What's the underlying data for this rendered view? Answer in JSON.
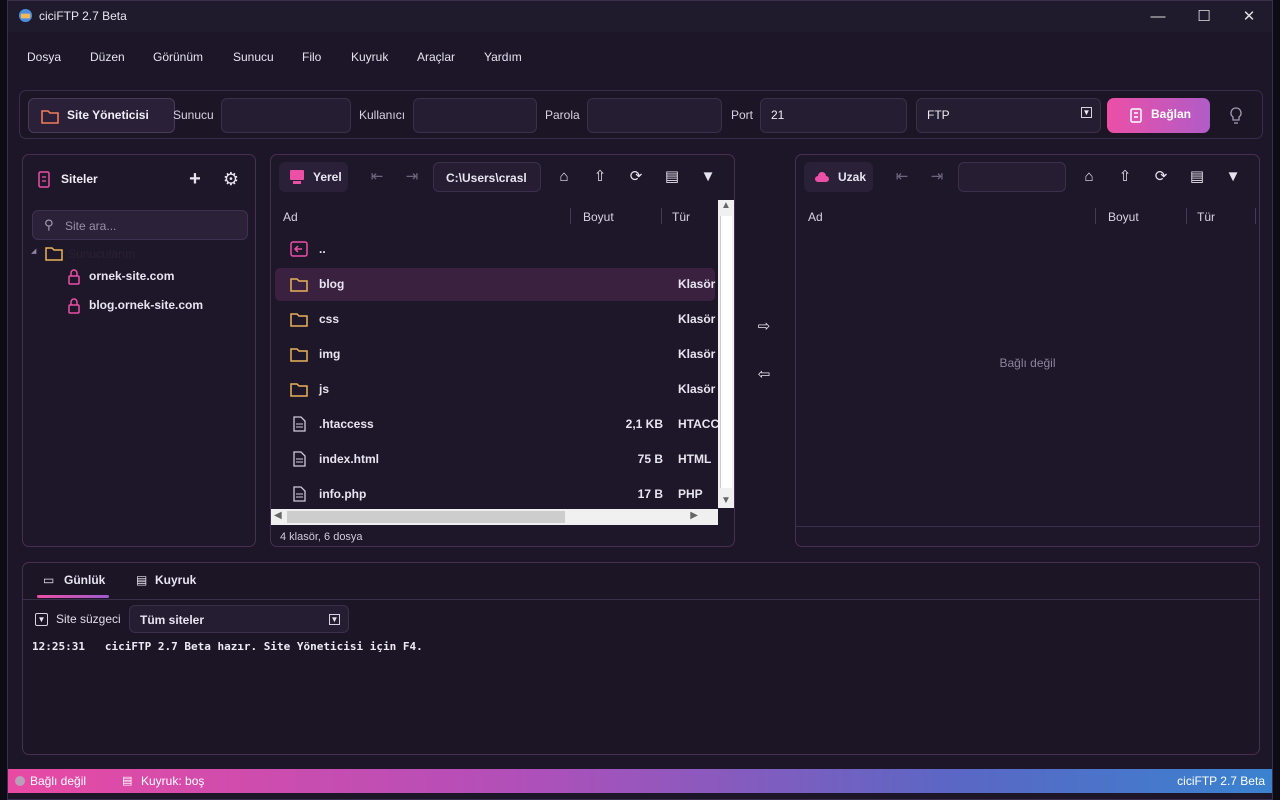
{
  "window": {
    "title": "ciciFTP 2.7 Beta"
  },
  "menu": [
    "Dosya",
    "Düzen",
    "Görünüm",
    "Sunucu",
    "Filo",
    "Kuyruk",
    "Araçlar",
    "Yardım"
  ],
  "toolbar": {
    "site_manager_label": "Site Yöneticisi",
    "host_label": "Sunucu",
    "user_label": "Kullanıcı",
    "password_label": "Parola",
    "port_label": "Port",
    "port_value": "21",
    "protocol_value": "FTP",
    "connect_label": "Bağlan"
  },
  "sites": {
    "title": "Siteler",
    "search_placeholder": "Site ara...",
    "group": "Sunucularım",
    "items": [
      "ornek-site.com",
      "blog.ornek-site.com"
    ]
  },
  "local": {
    "chip_label": "Yerel",
    "path": "C:\\Users\\crasl",
    "columns": {
      "name": "Ad",
      "size": "Boyut",
      "type": "Tür"
    },
    "rows": [
      {
        "name": "..",
        "size": "",
        "type": "",
        "kind": "up"
      },
      {
        "name": "blog",
        "size": "",
        "type": "Klasör",
        "kind": "folder"
      },
      {
        "name": "css",
        "size": "",
        "type": "Klasör",
        "kind": "folder"
      },
      {
        "name": "img",
        "size": "",
        "type": "Klasör",
        "kind": "folder"
      },
      {
        "name": "js",
        "size": "",
        "type": "Klasör",
        "kind": "folder"
      },
      {
        "name": ".htaccess",
        "size": "2,1 KB",
        "type": "HTACCESS",
        "kind": "file"
      },
      {
        "name": "index.html",
        "size": "75 B",
        "type": "HTML",
        "kind": "file"
      },
      {
        "name": "info.php",
        "size": "17 B",
        "type": "PHP",
        "kind": "file"
      }
    ],
    "footer": "4 klasör, 6 dosya"
  },
  "remote": {
    "chip_label": "Uzak",
    "path": "",
    "columns": {
      "name": "Ad",
      "size": "Boyut",
      "type": "Tür"
    },
    "empty_text": "Bağlı değil"
  },
  "log": {
    "tab_log": "Günlük",
    "tab_queue": "Kuyruk",
    "filter_label": "Site süzgeci",
    "filter_value": "Tüm siteler",
    "line_time": "12:25:31",
    "line_text": "ciciFTP 2.7 Beta hazır. Site Yöneticisi için F4."
  },
  "status": {
    "connection": "Bağlı değil",
    "queue": "Kuyruk: boş",
    "version": "ciciFTP 2.7 Beta"
  },
  "colors": {
    "accent": "#ec4fa6",
    "folder": "#e7b25a",
    "bg": "#1c1628"
  }
}
